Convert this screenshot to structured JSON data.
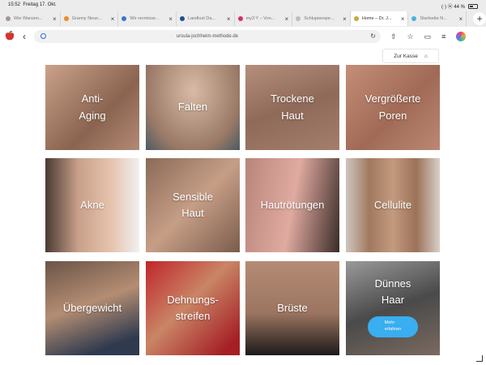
{
  "status": {
    "time": "15:52",
    "date": "Freitag 17. Okt.",
    "right": "(·) ⓦ 44 %"
  },
  "tabs": [
    {
      "title": "Wie Wanzen...",
      "color": "#9a9a9a"
    },
    {
      "title": "Granny Neue...",
      "color": "#f08a24"
    },
    {
      "title": "Wir vermisse...",
      "color": "#3a76c6"
    },
    {
      "title": "Landlust Da...",
      "color": "#1e4e8c"
    },
    {
      "title": "my3:Y – Von...",
      "color": "#d2306a"
    },
    {
      "title": "Schlupwespe...",
      "color": "#bdbdbd"
    },
    {
      "title": "Home – Dr. J...",
      "color": "#c7a93a",
      "active": true
    },
    {
      "title": "Startseite N...",
      "color": "#4ab0e0"
    }
  ],
  "toolbar": {
    "url": "ursula-jochheim-methode.de"
  },
  "shop": {
    "cart_label": "Zur Kasse"
  },
  "tiles": [
    {
      "label": "Anti-\nAging",
      "bg": "linear-gradient(135deg,#caa28a,#8a6450 60%,#b38a74)"
    },
    {
      "label": "Falten",
      "bg": "radial-gradient(ellipse at 50% 30%,#d8bba6,#9a7a66 70%,#4c5a64)"
    },
    {
      "label": "Trockene\nHaut",
      "bg": "linear-gradient(160deg,#b58f7c,#8f6a59 50%,#a47e6c)"
    },
    {
      "label": "Vergrößerte\nPoren",
      "bg": "linear-gradient(135deg,#c48e78,#a06a56 55%,#bb8874)"
    },
    {
      "label": "Akne",
      "bg": "linear-gradient(90deg,#4a3a33 0%,#c9a08a 35%,#e6c3ae 70%,#f0f0f0 100%)"
    },
    {
      "label": "Sensible\nHaut",
      "bg": "linear-gradient(135deg,#8a6a58,#c69e86 50%,#7a5c4c)"
    },
    {
      "label": "Hautrötungen",
      "bg": "linear-gradient(100deg,#b9857a 0%,#e0aaa0 50%,#3a2c27 100%)"
    },
    {
      "label": "Cellulite",
      "bg": "linear-gradient(90deg,#cfc6bf 0%,#a0795f 25%,#c39a7e 50%,#9b7259 75%,#d8d0c8 100%)"
    },
    {
      "label": "Übergewicht",
      "bg": "linear-gradient(160deg,#6b5447,#b48d73 45%,#2f3a4e 85%)"
    },
    {
      "label": "Dehnungs-\nstreifen",
      "bg": "linear-gradient(135deg,#c0262a,#c98566 45%,#a51f25 90%)"
    },
    {
      "label": "Brüste",
      "bg": "linear-gradient(180deg,#b48c75 0%,#9c7561 55%,#1c1a1a 100%)"
    },
    {
      "label": "Dünnes\nHaar",
      "bg": "linear-gradient(160deg,#9a9a9a,#4a4a4a 50%,#7a6a60)",
      "more": "Mehr\nerfahren"
    }
  ]
}
